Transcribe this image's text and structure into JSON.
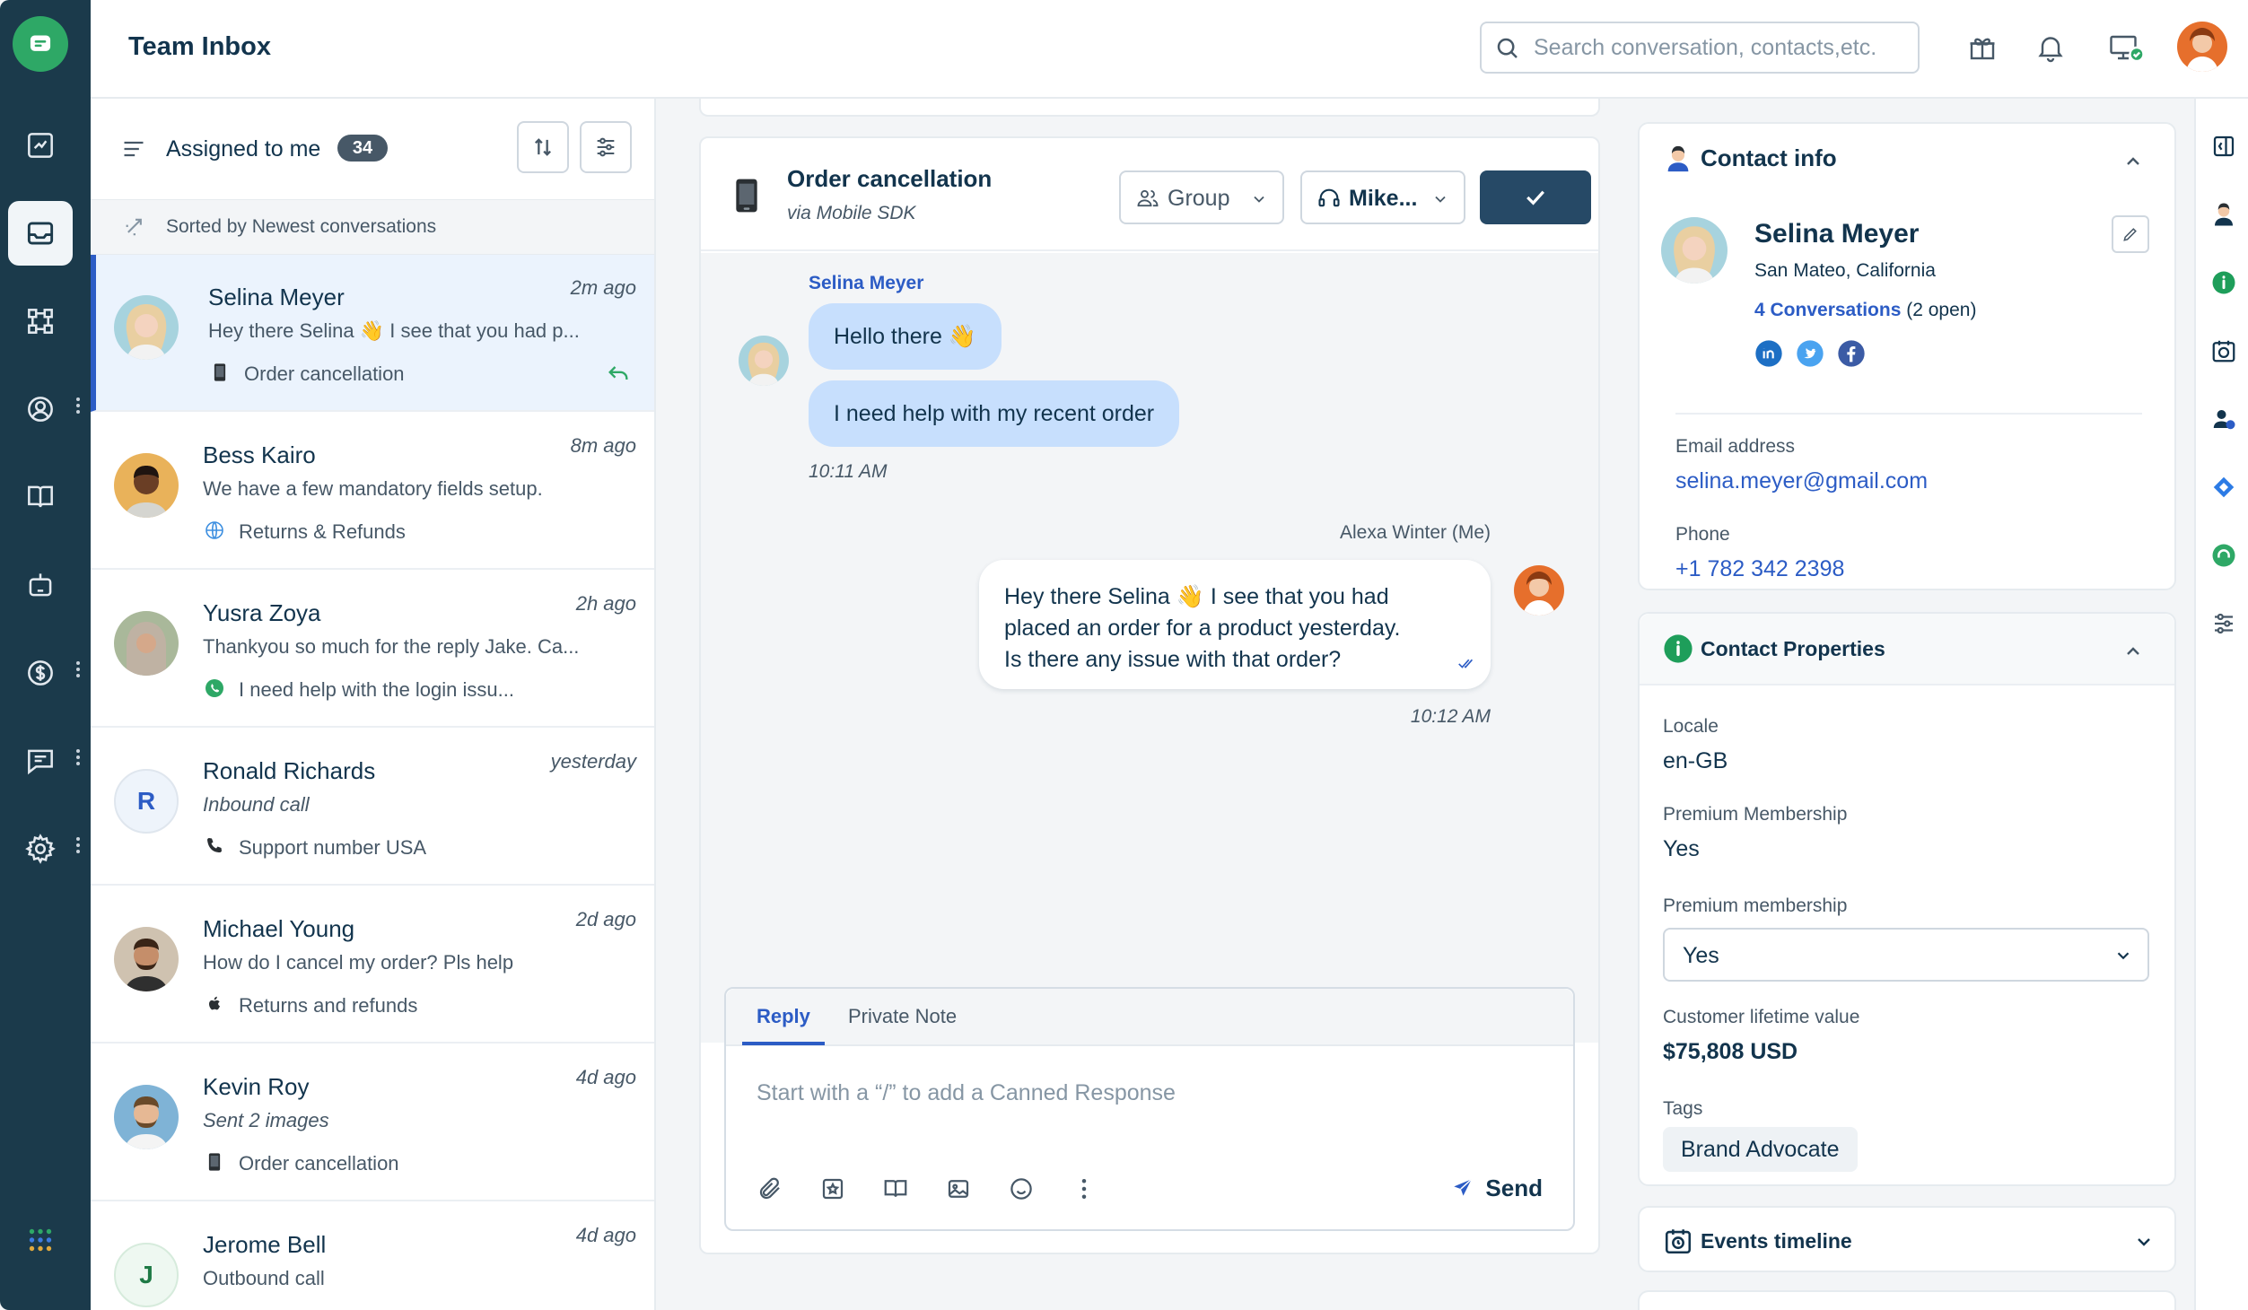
{
  "app": {
    "title": "Team Inbox"
  },
  "search": {
    "placeholder": "Search conversation, contacts,etc."
  },
  "list": {
    "title": "Assigned to me",
    "count": "34",
    "sorted_label": "Sorted by Newest conversations",
    "conversations": [
      {
        "name": "Selina Meyer",
        "time": "2m ago",
        "preview": "Hey there Selina 👋 I see that you had p...",
        "channel": "Order cancellation",
        "channel_icon": "mobile-icon",
        "active": true
      },
      {
        "name": "Bess Kairo",
        "time": "8m ago",
        "preview": "We have a few mandatory fields setup.",
        "channel": "Returns & Refunds",
        "channel_icon": "globe-icon"
      },
      {
        "name": "Yusra Zoya",
        "time": "2h ago",
        "preview": "Thankyou so much for the reply Jake. Ca...",
        "channel": "I need help with the login issu...",
        "channel_icon": "whatsapp-icon"
      },
      {
        "name": "Ronald Richards",
        "time": "yesterday",
        "preview": "Inbound call",
        "channel": "Support number USA",
        "channel_icon": "phone-icon",
        "initial": "R"
      },
      {
        "name": "Michael Young",
        "time": "2d ago",
        "preview": "How do I cancel my order? Pls help",
        "channel": "Returns and refunds",
        "channel_icon": "apple-icon"
      },
      {
        "name": "Kevin Roy",
        "time": "4d ago",
        "preview": "Sent 2 images",
        "channel": "Order cancellation",
        "channel_icon": "mobile-icon"
      },
      {
        "name": "Jerome Bell",
        "time": "4d ago",
        "preview": "Outbound call",
        "channel": "",
        "channel_icon": "phone-icon",
        "initial": "J"
      }
    ]
  },
  "chat": {
    "title": "Order cancellation",
    "subtitle": "via Mobile SDK",
    "group_label": "Group",
    "agent_label": "Mike...",
    "sender_name": "Selina Meyer",
    "msg1": "Hello there 👋",
    "msg2": "I need help with my recent order",
    "time_in": "10:11 AM",
    "agent_name": "Alexa Winter (Me)",
    "reply_line1": "Hey there Selina 👋 I see that you had",
    "reply_line2": "placed an order for a product yesterday.",
    "reply_line3": "Is there any issue with that order?",
    "time_out": "10:12 AM"
  },
  "reply": {
    "tab_reply": "Reply",
    "tab_note": "Private Note",
    "placeholder": "Start with a “/” to add a Canned Response",
    "send_label": "Send"
  },
  "contact": {
    "section_title": "Contact info",
    "name": "Selina Meyer",
    "location": "San Mateo, California",
    "conversations_link": "4 Conversations",
    "conversations_open": "(2 open)",
    "email_label": "Email address",
    "email": "selina.meyer@gmail.com",
    "phone_label": "Phone",
    "phone": "+1 782 342 2398"
  },
  "properties": {
    "section_title": "Contact Properties",
    "locale_label": "Locale",
    "locale": "en-GB",
    "premium_label": "Premium Membership",
    "premium": "Yes",
    "premium_select_label": "Premium membership",
    "premium_select": "Yes",
    "clv_label": "Customer lifetime value",
    "clv": "$75,808 USD",
    "tags_label": "Tags",
    "tag": "Brand Advocate"
  },
  "events": {
    "section_title": "Events timeline"
  },
  "colors": {
    "rail": "#1b3a4b",
    "accent": "#2c5cc5",
    "bubble_in": "#c7dffd",
    "resolve": "#264966"
  }
}
